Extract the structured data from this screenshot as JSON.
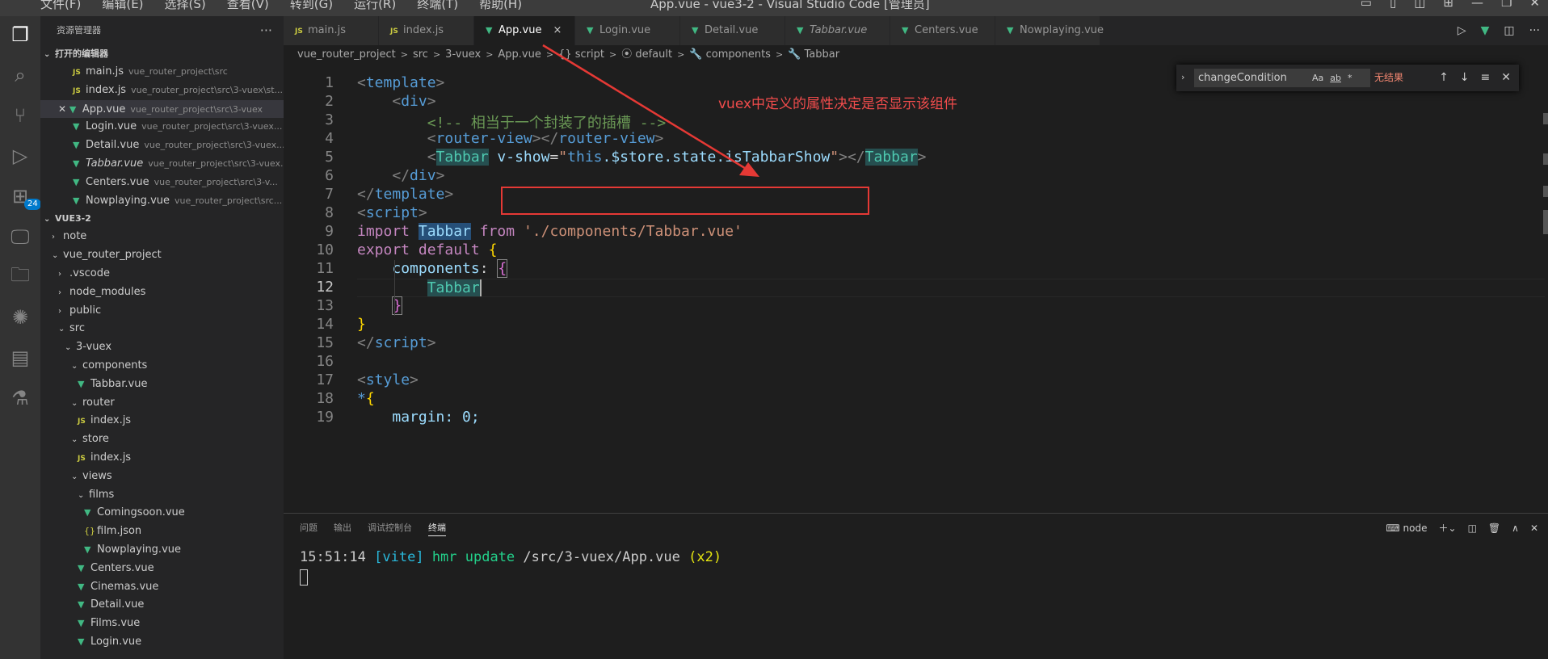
{
  "titlebar": {
    "menus": [
      "文件(F)",
      "编辑(E)",
      "选择(S)",
      "查看(V)",
      "转到(G)",
      "运行(R)",
      "终端(T)",
      "帮助(H)"
    ],
    "title": "App.vue - vue3-2 - Visual Studio Code [管理员]"
  },
  "activity": {
    "badge": "24"
  },
  "sidebar": {
    "header": "资源管理器",
    "open_editors_title": "打开的编辑器",
    "open_editors": [
      {
        "icon": "JS",
        "name": "main.js",
        "path": "vue_router_project\\src"
      },
      {
        "icon": "JS",
        "name": "index.js",
        "path": "vue_router_project\\src\\3-vuex\\st..."
      },
      {
        "icon": "V",
        "name": "App.vue",
        "path": "vue_router_project\\src\\3-vuex"
      },
      {
        "icon": "V",
        "name": "Login.vue",
        "path": "vue_router_project\\src\\3-vuex..."
      },
      {
        "icon": "V",
        "name": "Detail.vue",
        "path": "vue_router_project\\src\\3-vuex..."
      },
      {
        "icon": "V",
        "name": "Tabbar.vue",
        "path": "vue_router_project\\src\\3-vuex..."
      },
      {
        "icon": "V",
        "name": "Centers.vue",
        "path": "vue_router_project\\src\\3-v..."
      },
      {
        "icon": "V",
        "name": "Nowplaying.vue",
        "path": "vue_router_project\\src..."
      }
    ],
    "workspace_title": "VUE3-2",
    "tree": [
      {
        "label": "note",
        "chev": "›"
      },
      {
        "label": "vue_router_project",
        "chev": "⌄"
      },
      {
        "label": ".vscode",
        "chev": "›"
      },
      {
        "label": "node_modules",
        "chev": "›"
      },
      {
        "label": "public",
        "chev": "›"
      },
      {
        "label": "src",
        "chev": "⌄"
      },
      {
        "label": "3-vuex",
        "chev": "⌄"
      },
      {
        "label": "components",
        "chev": "⌄"
      },
      {
        "label": "Tabbar.vue",
        "icon": "V"
      },
      {
        "label": "router",
        "chev": "⌄"
      },
      {
        "label": "index.js",
        "icon": "JS"
      },
      {
        "label": "store",
        "chev": "⌄"
      },
      {
        "label": "index.js",
        "icon": "JS"
      },
      {
        "label": "views",
        "chev": "⌄"
      },
      {
        "label": "films",
        "chev": "⌄"
      },
      {
        "label": "Comingsoon.vue",
        "icon": "V"
      },
      {
        "label": "film.json",
        "icon": "{}"
      },
      {
        "label": "Nowplaying.vue",
        "icon": "V"
      },
      {
        "label": "Centers.vue",
        "icon": "V"
      },
      {
        "label": "Cinemas.vue",
        "icon": "V"
      },
      {
        "label": "Detail.vue",
        "icon": "V"
      },
      {
        "label": "Films.vue",
        "icon": "V"
      },
      {
        "label": "Login.vue",
        "icon": "V"
      }
    ]
  },
  "tabs": [
    {
      "icon": "JS",
      "label": "main.js"
    },
    {
      "icon": "JS",
      "label": "index.js"
    },
    {
      "icon": "V",
      "label": "App.vue",
      "close": "×"
    },
    {
      "icon": "V",
      "label": "Login.vue"
    },
    {
      "icon": "V",
      "label": "Detail.vue"
    },
    {
      "icon": "V",
      "label": "Tabbar.vue"
    },
    {
      "icon": "V",
      "label": "Centers.vue"
    },
    {
      "icon": "V",
      "label": "Nowplaying.vue"
    }
  ],
  "breadcrumb": [
    "vue_router_project",
    ">",
    "src",
    ">",
    "3-vuex",
    ">",
    "App.vue",
    ">",
    "{} script",
    ">",
    "⦿ default",
    ">",
    "🔧 components",
    ">",
    "🔧 Tabbar"
  ],
  "find": {
    "value": "changeCondition",
    "result": "无结果",
    "opts": [
      "Aa",
      "ab",
      "*"
    ]
  },
  "annotation": "vuex中定义的属性决定是否显示该组件",
  "line_numbers": [
    "1",
    "2",
    "3",
    "4",
    "5",
    "6",
    "7",
    "8",
    "9",
    "10",
    "11",
    "12",
    "13",
    "14",
    "15",
    "16",
    "17",
    "18",
    "19"
  ],
  "code": {
    "l1": "template",
    "l2": "div",
    "l3": "<!-- 相当于一个封装了的插槽 -->",
    "l4a": "router-view",
    "l4b": "router-view",
    "l5comp": "Tabbar",
    "l5attr": "v-show",
    "l5val": "this",
    "l5rest": ".$store.state.isTabbarShow",
    "l5close": "Tabbar",
    "l6": "div",
    "l7": "template",
    "l8": "script",
    "l9kw": "import",
    "l9id": "Tabbar",
    "l9from": "from",
    "l9str": "'./components/Tabbar.vue'",
    "l10a": "export",
    "l10b": "default",
    "l11": "components",
    "l12": "Tabbar",
    "l15": "script",
    "l17": "style",
    "l19": "margin: 0;"
  },
  "panel": {
    "tabs": [
      "问题",
      "输出",
      "调试控制台",
      "终端"
    ],
    "shell": "node",
    "term_time": "15:51:14",
    "term_vite": "[vite]",
    "term_hmr": "hmr update",
    "term_path": "/src/3-vuex/App.vue",
    "term_x": "(x2)"
  }
}
